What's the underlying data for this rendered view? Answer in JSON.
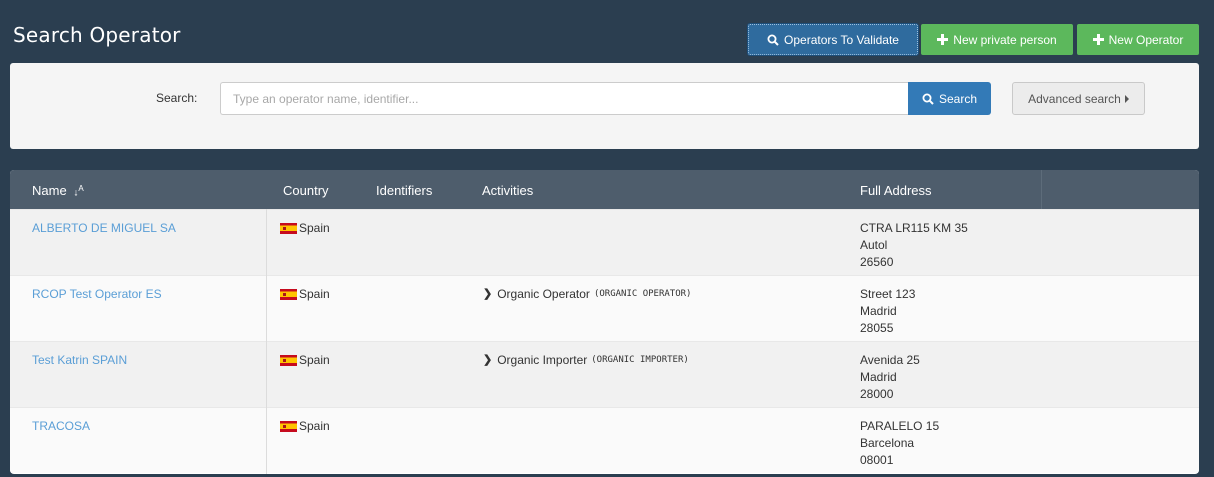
{
  "header": {
    "title": "Search Operator",
    "buttons": {
      "operators_to_validate": "Operators To Validate",
      "new_private_person": "New private person",
      "new_operator": "New Operator"
    }
  },
  "search": {
    "label": "Search:",
    "placeholder": "Type an operator name, identifier...",
    "button_label": "Search",
    "advanced_label": "Advanced search"
  },
  "table": {
    "columns": {
      "name": "Name",
      "country": "Country",
      "identifiers": "Identifiers",
      "activities": "Activities",
      "full_address": "Full Address"
    },
    "rows": [
      {
        "name": "ALBERTO DE MIGUEL SA",
        "country": "Spain",
        "activity": "",
        "activity_code": "",
        "address": [
          "CTRA LR115 KM 35",
          "Autol",
          "26560"
        ]
      },
      {
        "name": "RCOP Test Operator ES",
        "country": "Spain",
        "activity": "Organic Operator",
        "activity_code": "(ORGANIC OPERATOR)",
        "address": [
          "Street 123",
          "Madrid",
          "28055"
        ]
      },
      {
        "name": "Test Katrin SPAIN",
        "country": "Spain",
        "activity": "Organic Importer",
        "activity_code": "(ORGANIC IMPORTER)",
        "address": [
          "Avenida 25",
          "Madrid",
          "28000"
        ]
      },
      {
        "name": "TRACOSA",
        "country": "Spain",
        "activity": "",
        "activity_code": "",
        "address": [
          "PARALELO 15",
          "Barcelona",
          "08001"
        ]
      }
    ]
  },
  "icons": {
    "search": "search-icon",
    "plus": "plus-icon",
    "sort": "sort-alpha-icon",
    "flag": "spain-flag-icon",
    "chevron": "chevron-right-icon"
  },
  "colors": {
    "background": "#2b3e50",
    "primary": "#337ab7",
    "success": "#5cb85c",
    "link": "#5a9ed6",
    "table_header": "#4e5d6c"
  }
}
